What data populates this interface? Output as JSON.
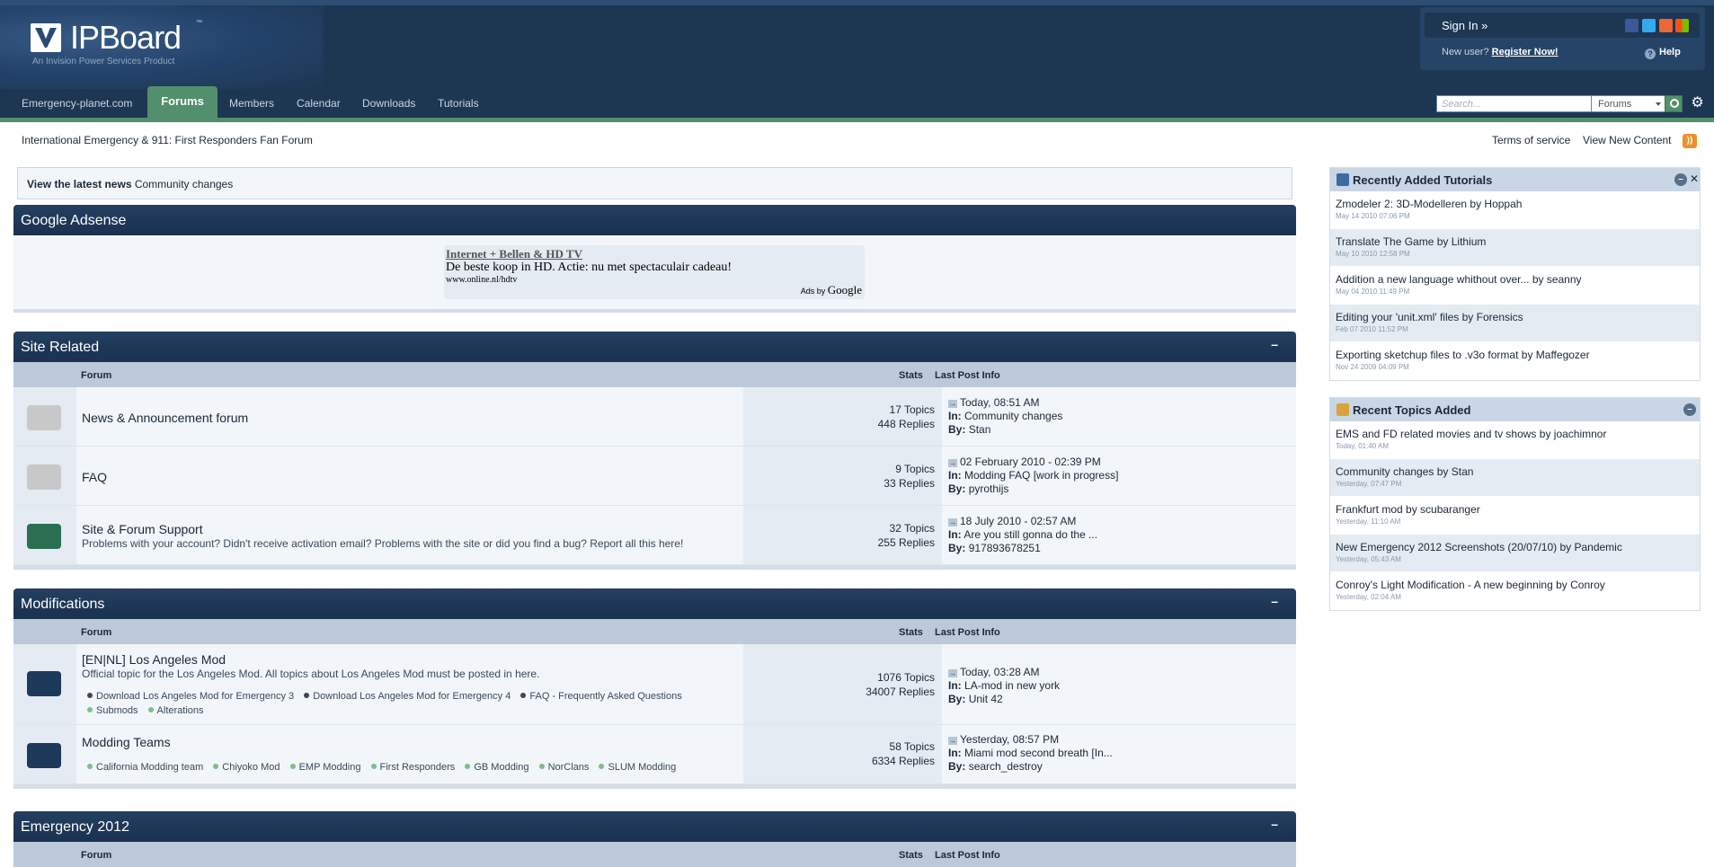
{
  "brand": {
    "name": "IPBoard",
    "tm": "™",
    "tagline": "An Invision Power Services Product"
  },
  "userbar": {
    "sign_in": "Sign In »",
    "new_user": "New user?",
    "register": "Register Now!",
    "help": "Help"
  },
  "nav": {
    "tabs": [
      "Emergency-planet.com",
      "Forums",
      "Members",
      "Calendar",
      "Downloads",
      "Tutorials"
    ],
    "active": "Forums"
  },
  "search": {
    "placeholder": "Search...",
    "scope": "Forums"
  },
  "breadcrumb": "International Emergency & 911: First Responders Fan Forum",
  "top_links": {
    "terms": "Terms of service",
    "new_content": "View New Content"
  },
  "news": {
    "label": "View the latest news",
    "title": "Community changes"
  },
  "ads": {
    "header": "Google Adsense",
    "title": "Internet + Bellen & HD TV",
    "text": "De beste koop in HD. Actie: nu met spectaculair cadeau!",
    "url": "www.online.nl/hdtv",
    "ads_by": "Ads by",
    "google": "Google"
  },
  "columns": {
    "forum": "Forum",
    "stats": "Stats",
    "last_post": "Last Post Info"
  },
  "labels": {
    "in": "In:",
    "by": "By:"
  },
  "categories": [
    {
      "title": "Site Related",
      "forums": [
        {
          "name": "News & Announcement forum",
          "desc": "",
          "topics": "17 Topics",
          "replies": "448 Replies",
          "date": "Today, 08:51 AM",
          "in": "Community changes",
          "by": "Stan"
        },
        {
          "name": "FAQ",
          "desc": "",
          "topics": "9 Topics",
          "replies": "33 Replies",
          "date": "02 February 2010 - 02:39 PM",
          "in": "Modding FAQ [work in progress]",
          "by": "pyrothijs"
        },
        {
          "name": "Site & Forum Support",
          "desc": "Problems with your account? Didn't receive activation email? Problems with the site or did you find a bug? Report all this here!",
          "topics": "32 Topics",
          "replies": "255 Replies",
          "date": "18 July 2010 - 02:57 AM",
          "in": "Are you still gonna do the ...",
          "by": "917893678251"
        }
      ]
    },
    {
      "title": "Modifications",
      "forums": [
        {
          "name": "[EN|NL] Los Angeles Mod",
          "desc": "Official topic for the Los Angeles Mod. All topics about Los Angeles Mod must be posted in here.",
          "subforums": [
            "Download Los Angeles Mod for Emergency 3",
            "Download Los Angeles Mod for Emergency 4",
            "FAQ - Frequently Asked Questions",
            "Submods",
            "Alterations"
          ],
          "topics": "1076 Topics",
          "replies": "34007 Replies",
          "date": "Today, 03:28 AM",
          "in": "LA-mod in new york",
          "by": "Unit 42"
        },
        {
          "name": "Modding Teams",
          "desc": "",
          "subforums": [
            "California Modding team",
            "Chiyoko Mod",
            "EMP Modding",
            "First Responders",
            "GB Modding",
            "NorClans",
            "SLUM Modding"
          ],
          "topics": "58 Topics",
          "replies": "6334 Replies",
          "date": "Yesterday, 08:57 PM",
          "in": "Miami mod second breath [In...",
          "by": "search_destroy"
        }
      ]
    },
    {
      "title": "Emergency 2012"
    }
  ],
  "sidebar": {
    "tutorials": {
      "title": "Recently Added Tutorials",
      "items": [
        {
          "text": "Zmodeler 2: 3D-Modelleren by Hoppah",
          "date": "May 14 2010 07:06 PM"
        },
        {
          "text": "Translate The Game by Lithium",
          "date": "May 10 2010 12:58 PM"
        },
        {
          "text": "Addition a new language whithout over... by seanny",
          "date": "May 04 2010 11:49 PM"
        },
        {
          "text": "Editing your 'unit.xml' files by Forensics",
          "date": "Feb 07 2010 11:52 PM"
        },
        {
          "text": "Exporting sketchup files to .v3o format by Maffegozer",
          "date": "Nov 24 2009 04:09 PM"
        }
      ]
    },
    "topics": {
      "title": "Recent Topics Added",
      "items": [
        {
          "text": "EMS and FD related movies and tv shows by joachimnor",
          "date": "Today, 01:40 AM"
        },
        {
          "text": "Community changes by Stan",
          "date": "Yesterday, 07:47 PM"
        },
        {
          "text": "Frankfurt mod by scubaranger",
          "date": "Yesterday, 11:10 AM"
        },
        {
          "text": "New Emergency 2012 Screenshots (20/07/10) by Pandemic",
          "date": "Yesterday, 05:43 AM"
        },
        {
          "text": "Conroy's Light Modification - A new beginning by Conroy",
          "date": "Yesterday, 02:04 AM"
        }
      ]
    }
  },
  "colors": {
    "header": "#1d3652",
    "accent_green": "#528f6c",
    "row_bg": "#f2f5f9",
    "subheader": "#bcc9d9"
  }
}
